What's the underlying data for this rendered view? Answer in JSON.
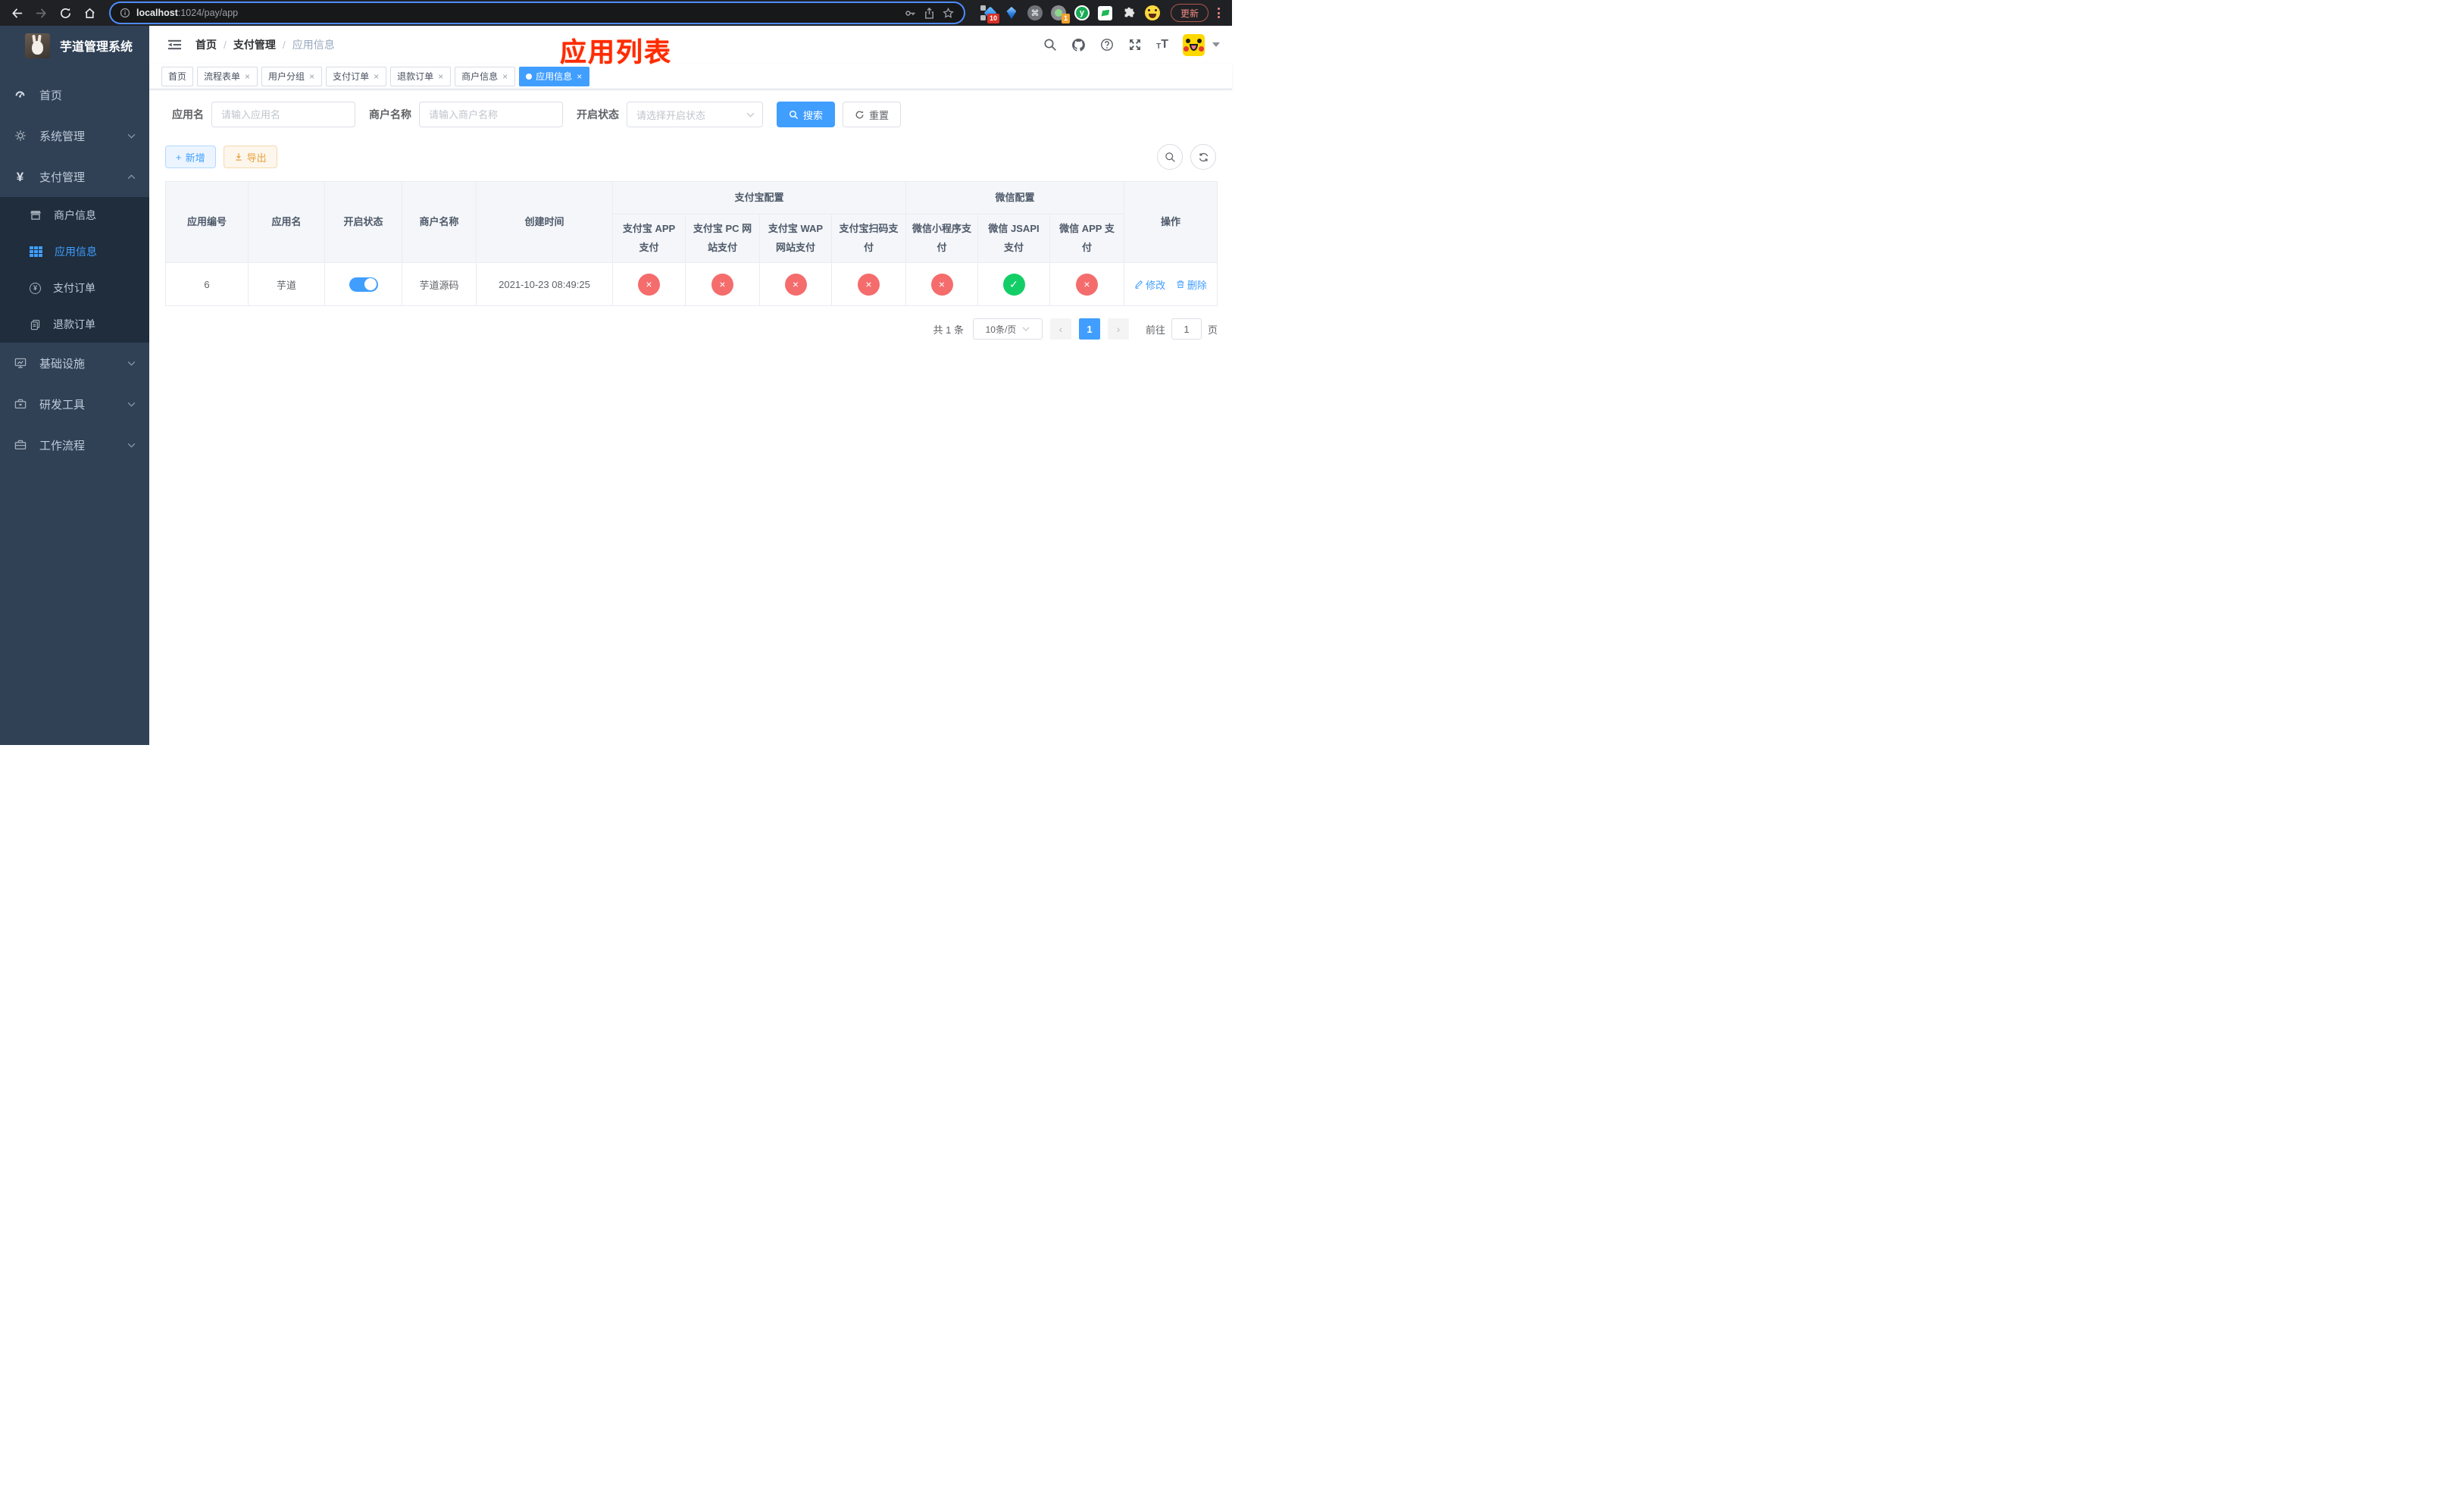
{
  "colors": {
    "primary": "#409eff",
    "success": "#13ce66",
    "danger": "#f56c6c",
    "warning": "#e6a23c",
    "annotation_red": "#ff2b00"
  },
  "icons": {
    "close": "×",
    "cross": "×",
    "check": "✓",
    "plus": "+",
    "yen": "¥",
    "question": "?",
    "command": "⌘",
    "letter_y": "y",
    "arrow_left": "‹",
    "arrow_right": "›",
    "text_small": "T",
    "text_large": "T"
  },
  "browser": {
    "url_host": "localhost",
    "url_path": ":1024/pay/app",
    "update_button": "更新",
    "extension_badge_10": "10",
    "extension_badge_1": "1"
  },
  "sidebar": {
    "title": "芋道管理系统",
    "menu": [
      {
        "label": "首页"
      },
      {
        "label": "系统管理"
      },
      {
        "label": "支付管理"
      },
      {
        "label": "基础设施"
      },
      {
        "label": "研发工具"
      },
      {
        "label": "工作流程"
      }
    ],
    "submenu": [
      {
        "label": "商户信息"
      },
      {
        "label": "应用信息"
      },
      {
        "label": "支付订单"
      },
      {
        "label": "退款订单"
      }
    ]
  },
  "navbar": {
    "breadcrumb": [
      "首页",
      "支付管理",
      "应用信息"
    ],
    "separator": "/"
  },
  "annotation": {
    "title": "应用列表"
  },
  "tags": [
    {
      "label": "首页"
    },
    {
      "label": "流程表单"
    },
    {
      "label": "用户分组"
    },
    {
      "label": "支付订单"
    },
    {
      "label": "退款订单"
    },
    {
      "label": "商户信息"
    },
    {
      "label": "应用信息"
    }
  ],
  "filter": {
    "app_name_label": "应用名",
    "app_name_placeholder": "请输入应用名",
    "merchant_name_label": "商户名称",
    "merchant_name_placeholder": "请输入商户名称",
    "status_label": "开启状态",
    "status_placeholder": "请选择开启状态",
    "search_button": "搜索",
    "reset_button": "重置"
  },
  "toolbar": {
    "add_button": "新增",
    "export_button": "导出"
  },
  "table": {
    "columns": [
      "应用编号",
      "应用名",
      "开启状态",
      "商户名称",
      "创建时间"
    ],
    "group_alipay": "支付宝配置",
    "group_wechat": "微信配置",
    "sub_columns": [
      "支付宝 APP 支付",
      "支付宝 PC 网站支付",
      "支付宝 WAP 网站支付",
      "支付宝扫码支付",
      "微信小程序支付",
      "微信 JSAPI 支付",
      "微信 APP 支付"
    ],
    "actions_column": "操作",
    "rows": [
      {
        "id": "6",
        "name": "芋道",
        "enabled": true,
        "merchant": "芋道源码",
        "created_at": "2021-10-23 08:49:25",
        "statuses": [
          false,
          false,
          false,
          false,
          false,
          true,
          false
        ],
        "edit_action": "修改",
        "delete_action": "删除"
      }
    ]
  },
  "pagination": {
    "total": "共 1 条",
    "page_size": "10条/页",
    "current_page": "1",
    "goto_label": "前往",
    "goto_value": "1",
    "page_unit": "页"
  }
}
